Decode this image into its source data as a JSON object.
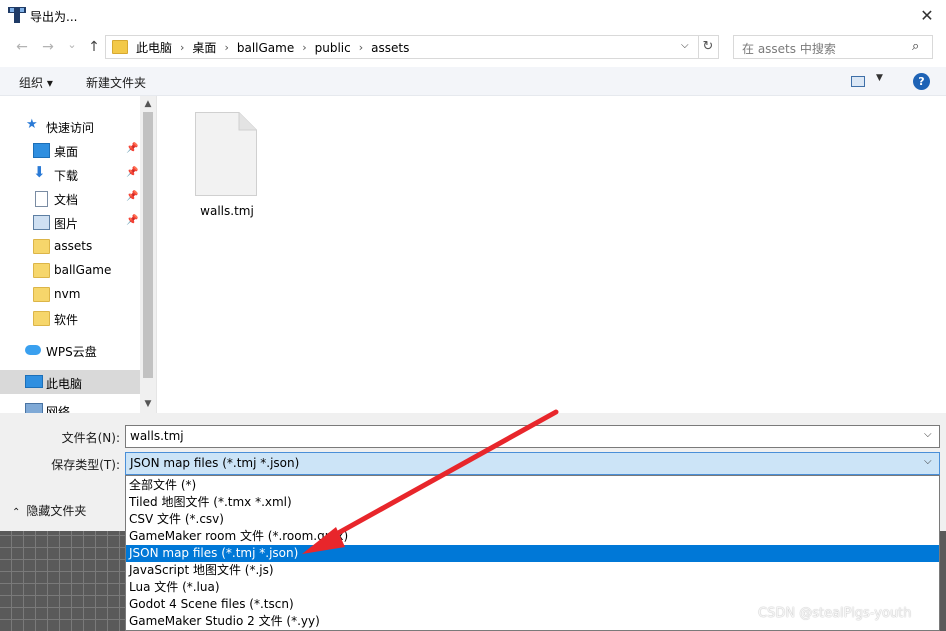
{
  "window": {
    "title": "导出为...",
    "close_glyph": "✕"
  },
  "nav": {
    "back_glyph": "←",
    "forward_glyph": "→",
    "recent_glyph": "⌄",
    "up_glyph": "↑",
    "breadcrumbs": [
      "此电脑",
      "桌面",
      "ballGame",
      "public",
      "assets"
    ],
    "refresh_glyph": "↻",
    "search_placeholder": "在 assets 中搜索"
  },
  "toolbar": {
    "organize": "组织 ▾",
    "new_folder": "新建文件夹",
    "help": "?"
  },
  "sidebar": {
    "items": [
      {
        "label": "快速访问",
        "icon": "star-icon"
      },
      {
        "label": "桌面",
        "icon": "desktop-icon",
        "pinned": true
      },
      {
        "label": "下载",
        "icon": "download-icon",
        "pinned": true
      },
      {
        "label": "文档",
        "icon": "document-icon",
        "pinned": true
      },
      {
        "label": "图片",
        "icon": "pictures-icon",
        "pinned": true
      },
      {
        "label": "assets",
        "icon": "folder-icon"
      },
      {
        "label": "ballGame",
        "icon": "folder-icon"
      },
      {
        "label": "nvm",
        "icon": "folder-icon"
      },
      {
        "label": "软件",
        "icon": "folder-icon"
      },
      {
        "label": "WPS云盘",
        "icon": "cloud-icon"
      },
      {
        "label": "此电脑",
        "icon": "computer-icon"
      },
      {
        "label": "网络",
        "icon": "network-icon"
      }
    ]
  },
  "files": [
    {
      "name": "walls.tmj"
    }
  ],
  "form": {
    "filename_label": "文件名(N):",
    "filename_value": "walls.tmj",
    "filetype_label": "保存类型(T):",
    "filetype_value": "JSON map files (*.tmj *.json)",
    "hide_folders": "隐藏文件夹"
  },
  "filetype_options": [
    "全部文件 (*)",
    "Tiled 地图文件 (*.tmx *.xml)",
    "CSV 文件 (*.csv)",
    "GameMaker room 文件 (*.room.gmx)",
    "JSON map files (*.tmj *.json)",
    "JavaScript 地图文件 (*.js)",
    "Lua 文件 (*.lua)",
    "Godot 4 Scene files (*.tscn)",
    "GameMaker Studio 2 文件 (*.yy)"
  ],
  "selected_option_index": 4,
  "watermark": "CSDN @stealPigs-youth",
  "colors": {
    "accent": "#0078d7",
    "annotation_arrow": "#e8262b",
    "folder": "#f6d66b"
  }
}
